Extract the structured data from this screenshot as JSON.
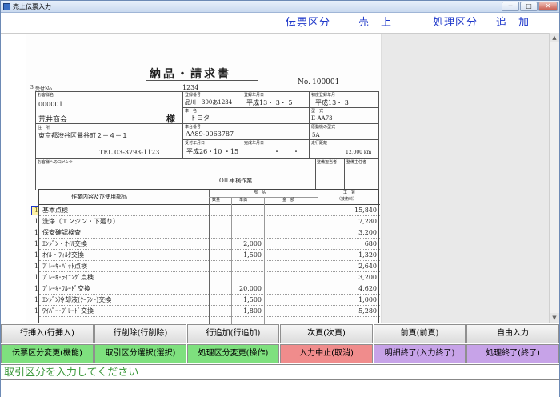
{
  "window": {
    "title": "売上伝票入力",
    "min": "─",
    "max": "□",
    "close": "✕"
  },
  "header": {
    "slip_type_label": "伝票区分",
    "slip_type_value": "売　上",
    "process_label": "処理区分",
    "process_value": "追　加"
  },
  "doc": {
    "title": "納品・請求書",
    "no_label": "No.",
    "no_value": "100001",
    "record_no_label": "受付No.",
    "record_no_value": "1234",
    "prefix_num": "3",
    "customer_code_label": "お客様名",
    "customer_code": "000001",
    "customer_name": "荒井商会",
    "honorific": "様",
    "address_label": "住　所",
    "address": "東京都渋谷区鶯谷町２－４－１",
    "tel": "TEL.03-3793-1123",
    "reg_no_label": "登録番号",
    "reg_no": "品川　300あ1234",
    "first_reg_label": "登録年月日",
    "first_reg": "平成13・ 3・ 5",
    "first_year_label": "初度登録年月",
    "first_year": "平成13・ 3",
    "car_name_label": "車　名",
    "car_name": "トヨタ",
    "model_label": "型　式",
    "model": "E-AA73",
    "chassis_label": "車台番号",
    "chassis": "AA89-0063787",
    "engine_label": "原動機の型式",
    "engine": "5A",
    "accept_label": "受付年月日",
    "accept": "平成26・10 ・15",
    "delivery_label": "完成年月日",
    "delivery_val": "・　　・",
    "mileage_label": "走行距離",
    "mileage": "12,000 km",
    "comment_label": "お客様へのコメント",
    "work_title": "OIL車検作業",
    "maint_label": "整備担当者",
    "chief_label": "整備主任者"
  },
  "table": {
    "h_desc": "作業内容及び使用部品",
    "h_parts": "部　品",
    "h_qty": "数量",
    "h_unit": "単価",
    "h_amount": "金　額",
    "h_labor": "工　賃",
    "h_labor_sub": "（技術料）",
    "rows": [
      {
        "q": "1",
        "desc": "基本点検",
        "unit": "",
        "labor": "15,840"
      },
      {
        "q": "1",
        "desc": "洗浄（エンジン・下廻り）",
        "unit": "",
        "labor": "7,280"
      },
      {
        "q": "1",
        "desc": "保安確認検査",
        "unit": "",
        "labor": "3,200"
      },
      {
        "q": "1",
        "desc": "ｴﾝｼﾞﾝ・ｵｲﾙ交換",
        "unit": "2,000",
        "labor": "680"
      },
      {
        "q": "1",
        "desc": "ｵｲﾙ・ﾌｨﾙﾀ交換",
        "unit": "1,500",
        "labor": "1,320"
      },
      {
        "q": "1",
        "desc": "ﾌﾞﾚｰｷ･ﾊﾟｯﾄ点検",
        "unit": "",
        "labor": "2,640"
      },
      {
        "q": "1",
        "desc": "ﾌﾞﾚｰｷ･ﾗｲﾆﾝｸﾞ点検",
        "unit": "",
        "labor": "3,200"
      },
      {
        "q": "1",
        "desc": "ﾌﾞﾚｰｷ･ﾌﾙｰﾄﾞ交換",
        "unit": "20,000",
        "labor": "4,620"
      },
      {
        "q": "1",
        "desc": "ｴﾝｼﾞﾝ冷却液(ｸｰﾗﾝﾄ)交換",
        "unit": "1,500",
        "labor": "1,000"
      },
      {
        "q": "1",
        "desc": "ﾜｲﾊﾟｰ･ﾌﾞﾚｰﾄﾞ交換",
        "unit": "1,800",
        "labor": "5,280"
      }
    ]
  },
  "buttons_row1": [
    {
      "label": "行挿入(行挿入)"
    },
    {
      "label": "行削除(行削除)"
    },
    {
      "label": "行追加(行追加)"
    },
    {
      "label": "次頁(次頁)"
    },
    {
      "label": "前頁(前頁)"
    },
    {
      "label": "自由入力"
    }
  ],
  "buttons_row2": [
    {
      "label": "伝票区分変更(機能)",
      "color": "#7ee07e"
    },
    {
      "label": "取引区分選択(選択)",
      "color": "#7ee07e"
    },
    {
      "label": "処理区分変更(操作)",
      "color": "#7ee07e"
    },
    {
      "label": "入力中止(取消)",
      "color": "#f08c8c"
    },
    {
      "label": "明細終了(入力終了)",
      "color": "#c7a3e8"
    },
    {
      "label": "処理終了(終了)",
      "color": "#c7a3e8"
    }
  ],
  "message": "取引区分を入力してください"
}
